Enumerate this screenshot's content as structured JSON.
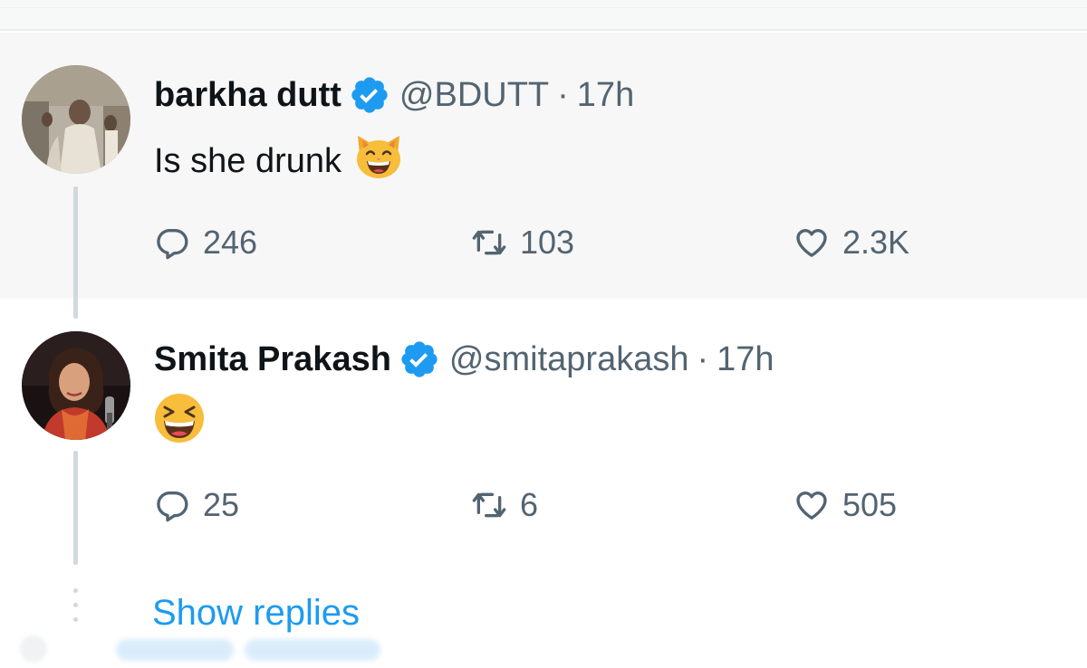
{
  "thread": {
    "tweets": [
      {
        "display_name": "barkha dutt",
        "handle": "@BDUTT",
        "separator": "·",
        "time": "17h",
        "verified": true,
        "text": "Is she drunk",
        "emoji": "grinning-cat-icon",
        "stats": {
          "replies": "246",
          "retweets": "103",
          "likes": "2.3K"
        }
      },
      {
        "display_name": "Smita Prakash",
        "handle": "@smitaprakash",
        "separator": "·",
        "time": "17h",
        "verified": true,
        "text": "",
        "emoji": "laughing-face-icon",
        "stats": {
          "replies": "25",
          "retweets": "6",
          "likes": "505"
        }
      }
    ],
    "show_replies_label": "Show replies"
  },
  "colors": {
    "verified_blue": "#1d9bf0",
    "secondary_text": "#536471",
    "primary_text": "#0f1419",
    "link_blue": "#1d9bf0",
    "highlight_background": "#f7f7f7"
  }
}
